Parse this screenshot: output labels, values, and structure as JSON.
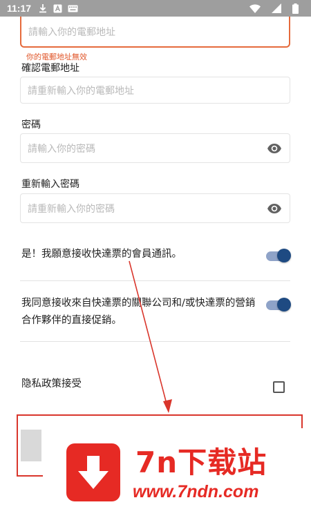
{
  "status_bar": {
    "time": "11:17",
    "icons": [
      "download-icon",
      "a-icon",
      "keyboard-icon",
      "wifi-icon",
      "signal-icon",
      "battery-icon"
    ]
  },
  "form": {
    "email": {
      "placeholder": "請輸入你的電郵地址",
      "error": "你的電郵地址無效"
    },
    "confirm_email": {
      "label": "確認電郵地址",
      "placeholder": "請重新輸入你的電郵地址"
    },
    "password": {
      "label": "密碼",
      "placeholder": "請輸入你的密碼"
    },
    "confirm_password": {
      "label": "重新輸入密碼",
      "placeholder": "請重新輸入你的密碼"
    }
  },
  "consents": {
    "newsletter": {
      "text": "是！我願意接收快達票的會員通訊。",
      "on": true
    },
    "partners": {
      "text": "我同意接收來自快達票的關聯公司和/或快達票的營銷合作夥伴的直接促銷。",
      "on": true
    },
    "privacy": {
      "text": "隐私政策接受",
      "checked": false
    }
  },
  "watermark": {
    "title": "7n下载站",
    "url": "www.7ndn.com"
  },
  "colors": {
    "accent": "#1e4a82",
    "error": "#e0562a",
    "annotation": "#d9352b",
    "watermark": "#e62a24"
  }
}
